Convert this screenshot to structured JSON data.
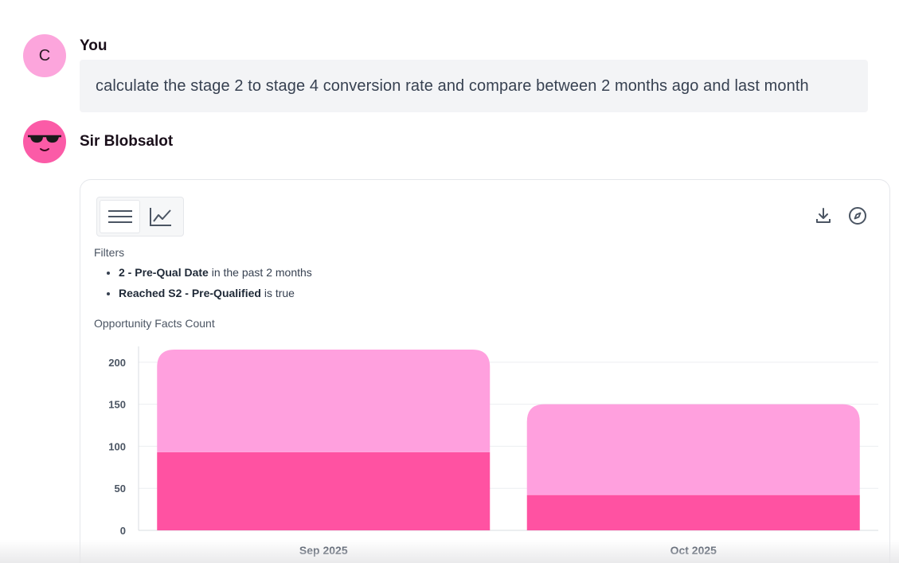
{
  "messages": {
    "user": {
      "avatar_initial": "C",
      "author": "You",
      "text": "calculate the stage 2 to stage 4 conversion rate and compare between 2 months ago and last month"
    },
    "bot": {
      "author": "Sir Blobsalot"
    }
  },
  "card": {
    "filters_label": "Filters",
    "filters": [
      {
        "field": "2 - Pre-Qual Date",
        "condition": " in the past 2 months"
      },
      {
        "field": "Reached S2 - Pre-Qualified",
        "condition": " is true"
      }
    ],
    "chart_title": "Opportunity Facts Count"
  },
  "chart_data": {
    "type": "bar",
    "stacked": true,
    "categories": [
      "Sep 2025",
      "Oct 2025"
    ],
    "series": [
      {
        "values": [
          93,
          42
        ],
        "color": "#ff52a2"
      },
      {
        "values": [
          122,
          108
        ],
        "color": "#ffa0de"
      }
    ],
    "y_ticks": [
      0,
      50,
      100,
      150,
      200
    ],
    "ylim": [
      0,
      215
    ],
    "grid": true
  },
  "colors": {
    "user_avatar": "#fca5dc",
    "bot_avatar": "#fb5ba7",
    "bubble_bg": "#f3f4f6"
  }
}
